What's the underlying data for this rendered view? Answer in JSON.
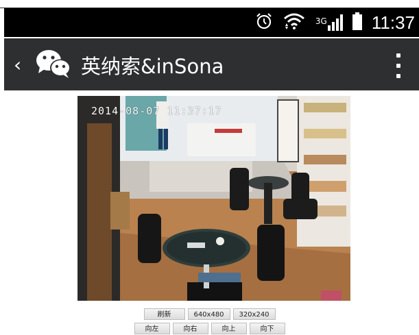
{
  "status_bar": {
    "network": "3G",
    "time": "11:37",
    "icons": [
      "alarm-icon",
      "wifi-icon",
      "signal-icon",
      "battery-icon"
    ]
  },
  "app_bar": {
    "title": "英纳索&inSona",
    "icons": [
      "back-chevron-icon",
      "wechat-logo-icon",
      "overflow-menu-icon"
    ]
  },
  "camera": {
    "timestamp": "2014-08-07 11:37:17"
  },
  "controls": {
    "row1": [
      "刷新",
      "640x480",
      "320x240"
    ],
    "row2": [
      "向左",
      "向右",
      "向上",
      "向下"
    ]
  },
  "colors": {
    "status_bar_bg": "#000000",
    "app_bar_bg": "#2e2f31"
  }
}
